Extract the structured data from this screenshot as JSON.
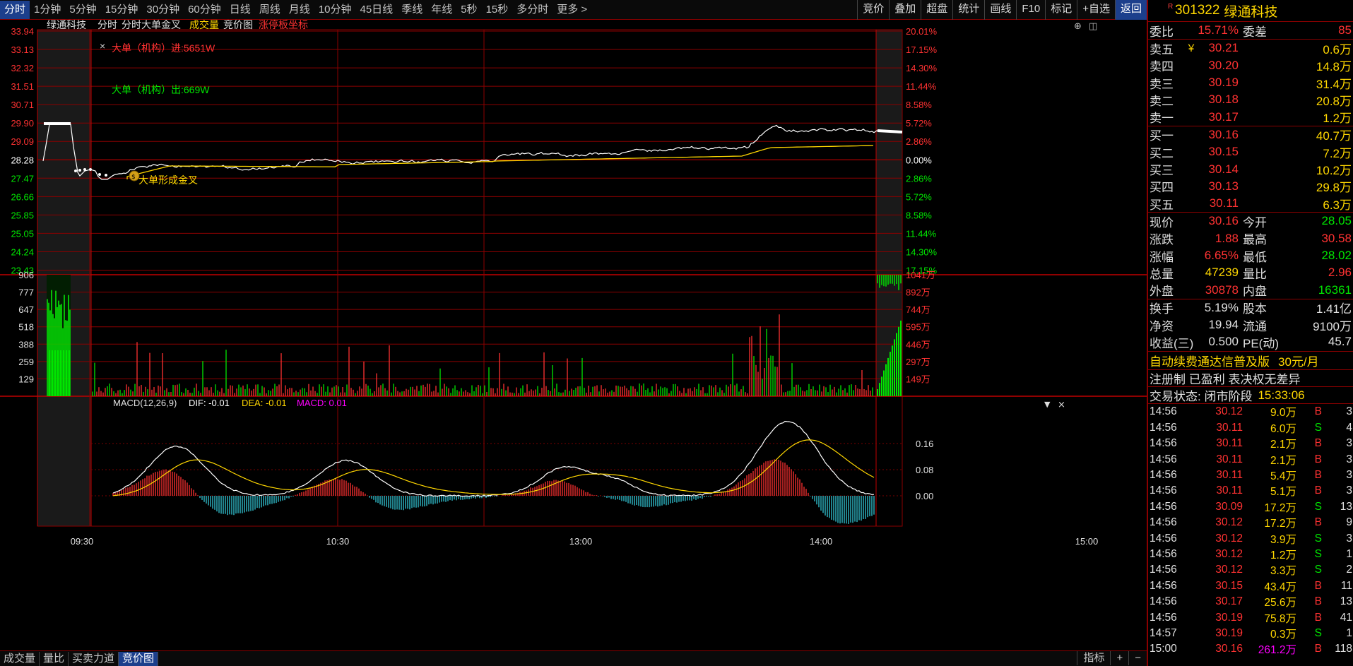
{
  "toolbar": {
    "periods": [
      "分时",
      "1分钟",
      "5分钟",
      "15分钟",
      "30分钟",
      "60分钟",
      "日线",
      "周线",
      "月线",
      "10分钟",
      "45日线",
      "季线",
      "年线",
      "5秒",
      "15秒",
      "多分时",
      "更多 >"
    ],
    "active": "分时",
    "right": [
      "竞价",
      "叠加",
      "超盘",
      "统计",
      "画线",
      "F10",
      "标记",
      "+自选",
      "返回"
    ]
  },
  "chart_header": {
    "stock": "绿通科技",
    "tabs": [
      "分时",
      "分时大单金叉"
    ],
    "vol": "成交量",
    "bid": "竞价图",
    "limit": "涨停板坐标"
  },
  "annotations": {
    "big_in": "大单（机构）进:5651W",
    "big_out": "大单（机构）出:669W",
    "cross": "大单形成金叉"
  },
  "price_axis": {
    "left": [
      "33.94",
      "33.13",
      "32.32",
      "31.51",
      "30.71",
      "29.90",
      "29.09",
      "28.28",
      "27.47",
      "26.66",
      "25.85",
      "25.05",
      "24.24",
      "23.43"
    ],
    "right": [
      "20.01%",
      "17.15%",
      "14.30%",
      "11.44%",
      "8.58%",
      "5.72%",
      "2.86%",
      "0.00%",
      "2.86%",
      "5.72%",
      "8.58%",
      "11.44%",
      "14.30%",
      "17.15%"
    ]
  },
  "volume_axis": {
    "left": [
      "906",
      "777",
      "647",
      "518",
      "388",
      "259",
      "129"
    ],
    "right": [
      "1041万",
      "892万",
      "744万",
      "595万",
      "446万",
      "297万",
      "149万"
    ]
  },
  "macd": {
    "label": "MACD(12,26,9)",
    "dif": "DIF: -0.01",
    "dea": "DEA: -0.01",
    "macd": "MACD: 0.01",
    "axis": [
      "0.16",
      "0.08",
      "0.00"
    ]
  },
  "time_axis": [
    "09:30",
    "10:30",
    "13:00",
    "14:00",
    "15:00"
  ],
  "bottom_tabs": [
    "成交量",
    "量比",
    "买卖力道",
    "竞价图"
  ],
  "bottom_active": "竞价图",
  "bottom_right": [
    "指标",
    "+",
    "−"
  ],
  "colors": {
    "up": "#ff3232",
    "down": "#00e600",
    "price": "#ffffff",
    "avg": "#ffd700",
    "grid": "#8b0000",
    "accent": "#1c3f8c"
  },
  "quote": {
    "code": "301322",
    "name": "绿通科技",
    "flag": "R",
    "weibi": {
      "l1": "委比",
      "v1": "15.71%",
      "l2": "委差",
      "v2": "85"
    },
    "sells": [
      {
        "label": "卖五",
        "mark": "￥",
        "price": "30.21",
        "vol": "0.6万"
      },
      {
        "label": "卖四",
        "price": "30.20",
        "vol": "14.8万"
      },
      {
        "label": "卖三",
        "price": "30.19",
        "vol": "31.4万"
      },
      {
        "label": "卖二",
        "price": "30.18",
        "vol": "20.8万"
      },
      {
        "label": "卖一",
        "price": "30.17",
        "vol": "1.2万"
      }
    ],
    "buys": [
      {
        "label": "买一",
        "price": "30.16",
        "vol": "40.7万"
      },
      {
        "label": "买二",
        "price": "30.15",
        "vol": "7.2万"
      },
      {
        "label": "买三",
        "price": "30.14",
        "vol": "10.2万"
      },
      {
        "label": "买四",
        "price": "30.13",
        "vol": "29.8万"
      },
      {
        "label": "买五",
        "price": "30.11",
        "vol": "6.3万"
      }
    ],
    "stats": [
      {
        "l1": "现价",
        "v1": "30.16",
        "c1": "red",
        "l2": "今开",
        "v2": "28.05",
        "c2": "green"
      },
      {
        "l1": "涨跌",
        "v1": "1.88",
        "c1": "red",
        "l2": "最高",
        "v2": "30.58",
        "c2": "red"
      },
      {
        "l1": "涨幅",
        "v1": "6.65%",
        "c1": "red",
        "l2": "最低",
        "v2": "28.02",
        "c2": "green"
      },
      {
        "l1": "总量",
        "v1": "47239",
        "c1": "yel",
        "l2": "量比",
        "v2": "2.96",
        "c2": "red"
      },
      {
        "l1": "外盘",
        "v1": "30878",
        "c1": "red",
        "l2": "内盘",
        "v2": "16361",
        "c2": "green"
      }
    ],
    "info": [
      {
        "l1": "换手",
        "v1": "5.19%",
        "l2": "股本",
        "v2": "1.41亿"
      },
      {
        "l1": "净资",
        "v1": "19.94",
        "l2": "流通",
        "v2": "9100万"
      },
      {
        "l1": "收益(三)",
        "v1": "0.500",
        "l2": "PE(动)",
        "v2": "45.7"
      }
    ],
    "ad": {
      "text": "自动续费通达信普及版",
      "price": "30元/月"
    },
    "tags": "注册制 已盈利 表决权无差异",
    "status": {
      "label": "交易状态: 闭市阶段",
      "time": "15:33:06"
    },
    "ticks": [
      {
        "t": "14:56",
        "p": "30.12",
        "v": "9.0万",
        "bs": "B",
        "n": "3"
      },
      {
        "t": "14:56",
        "p": "30.11",
        "v": "6.0万",
        "bs": "S",
        "n": "4"
      },
      {
        "t": "14:56",
        "p": "30.11",
        "v": "2.1万",
        "bs": "B",
        "n": "3"
      },
      {
        "t": "14:56",
        "p": "30.11",
        "v": "2.1万",
        "bs": "B",
        "n": "3"
      },
      {
        "t": "14:56",
        "p": "30.11",
        "v": "5.4万",
        "bs": "B",
        "n": "3"
      },
      {
        "t": "14:56",
        "p": "30.11",
        "v": "5.1万",
        "bs": "B",
        "n": "3"
      },
      {
        "t": "14:56",
        "p": "30.09",
        "v": "17.2万",
        "bs": "S",
        "n": "13"
      },
      {
        "t": "14:56",
        "p": "30.12",
        "v": "17.2万",
        "bs": "B",
        "n": "9"
      },
      {
        "t": "14:56",
        "p": "30.12",
        "v": "3.9万",
        "bs": "S",
        "n": "3"
      },
      {
        "t": "14:56",
        "p": "30.12",
        "v": "1.2万",
        "bs": "S",
        "n": "1"
      },
      {
        "t": "14:56",
        "p": "30.12",
        "v": "3.3万",
        "bs": "S",
        "n": "2"
      },
      {
        "t": "14:56",
        "p": "30.15",
        "v": "43.4万",
        "bs": "B",
        "n": "11"
      },
      {
        "t": "14:56",
        "p": "30.17",
        "v": "25.6万",
        "bs": "B",
        "n": "13"
      },
      {
        "t": "14:56",
        "p": "30.19",
        "v": "75.8万",
        "bs": "B",
        "n": "41"
      },
      {
        "t": "14:57",
        "p": "30.19",
        "v": "0.3万",
        "bs": "S",
        "n": "1"
      },
      {
        "t": "15:00",
        "p": "30.16",
        "v": "261.2万",
        "bs": "B",
        "n": "118"
      }
    ]
  }
}
